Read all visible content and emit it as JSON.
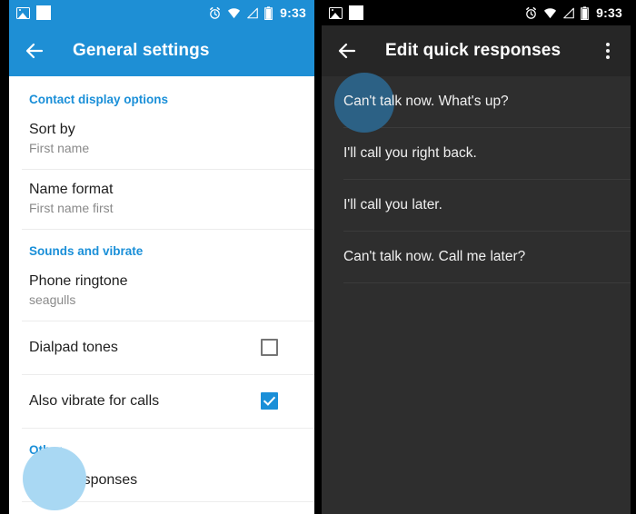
{
  "left_phone": {
    "statusbar": {
      "icons": [
        "photo-icon",
        "white-square-icon",
        "alarm-icon",
        "wifi-icon",
        "signal-icon",
        "battery-icon"
      ],
      "time": "9:33"
    },
    "toolbar": {
      "back_label": "back-arrow-icon",
      "title": "General settings"
    },
    "sections": [
      {
        "header": "Contact display options",
        "rows": [
          {
            "title": "Sort by",
            "subtitle": "First name",
            "control": "none"
          },
          {
            "title": "Name format",
            "subtitle": "First name first",
            "control": "none"
          }
        ]
      },
      {
        "header": "Sounds and vibrate",
        "rows": [
          {
            "title": "Phone ringtone",
            "subtitle": "seagulls",
            "control": "none"
          },
          {
            "title": "Dialpad tones",
            "subtitle": "",
            "control": "checkbox-unchecked"
          },
          {
            "title": "Also vibrate for calls",
            "subtitle": "",
            "control": "checkbox-checked"
          }
        ]
      },
      {
        "header": "Other",
        "rows": [
          {
            "title": "Quick responses",
            "subtitle": "",
            "control": "none"
          }
        ]
      }
    ]
  },
  "right_phone": {
    "statusbar": {
      "icons": [
        "photo-icon",
        "white-square-icon",
        "alarm-icon",
        "wifi-icon",
        "signal-icon",
        "battery-icon"
      ],
      "time": "9:33"
    },
    "toolbar": {
      "back_label": "back-arrow-icon",
      "title": "Edit quick responses",
      "overflow_label": "more-options-icon"
    },
    "quick_responses": [
      "Can't talk now. What's up?",
      "I'll call you right back.",
      "I'll call you later.",
      "Can't talk now. Call me later?"
    ]
  },
  "colors": {
    "accent_blue": "#1e8fd5",
    "section_header_blue": "#1a8fd8",
    "dark_bg": "#2e2e2e",
    "dark_toolbar": "#262626",
    "tap_light": "#a9d8f3",
    "tap_dark": "#2c6185"
  }
}
